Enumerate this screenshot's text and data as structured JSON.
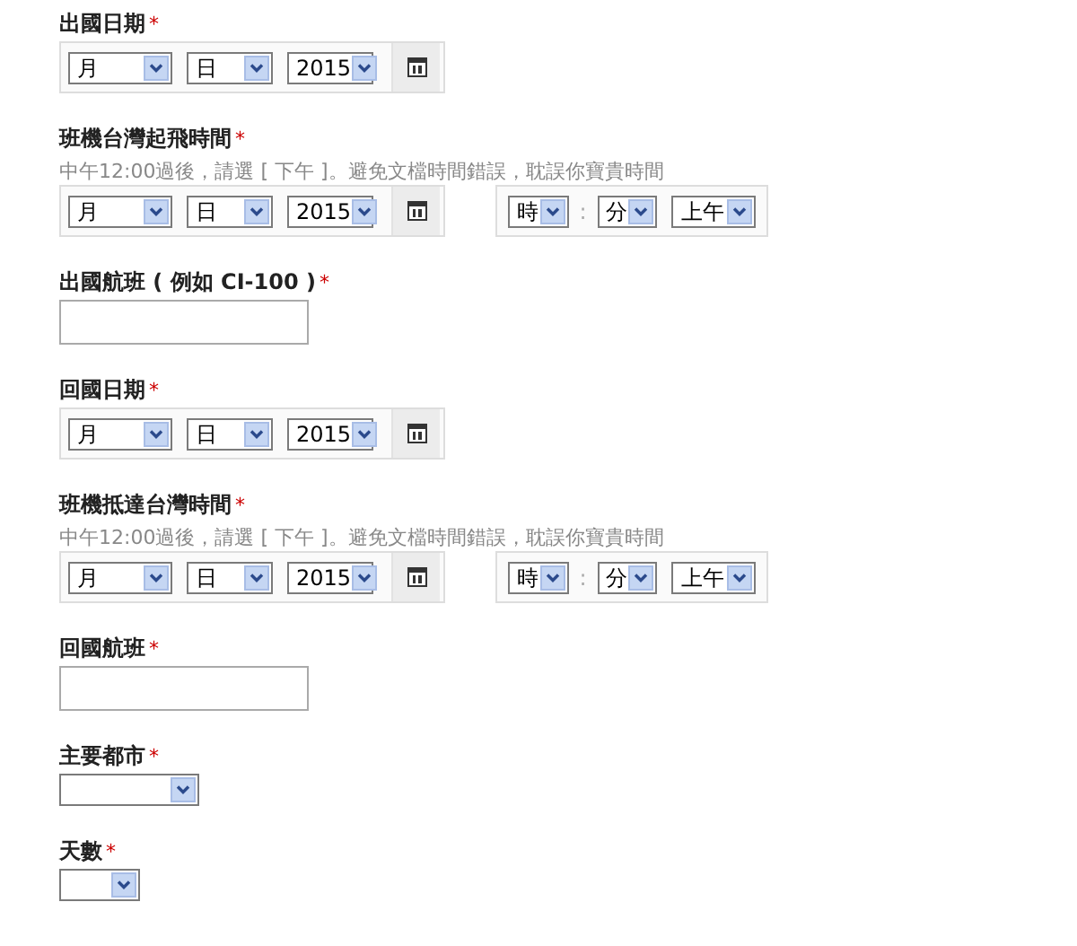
{
  "fields": [
    {
      "kind": "date",
      "label": "出國日期",
      "mark": "*",
      "date": [
        "月",
        "日",
        "2015"
      ]
    },
    {
      "kind": "datetime",
      "label": "班機台灣起飛時間",
      "mark": "*",
      "hint": "中午12:00過後，請選 [ 下午 ]。避免文檔時間錯誤，耽誤你寶貴時間",
      "date": [
        "月",
        "日",
        "2015"
      ],
      "time": [
        "時",
        "分",
        "上午"
      ],
      "separator": ":"
    },
    {
      "kind": "text",
      "label": "出國航班 ( 例如 CI-100 )",
      "mark": "*"
    },
    {
      "kind": "date",
      "label": "回國日期",
      "mark": "*",
      "date": [
        "月",
        "日",
        "2015"
      ]
    },
    {
      "kind": "datetime",
      "label": "班機抵達台灣時間",
      "mark": "*",
      "hint": "中午12:00過後，請選 [ 下午 ]。避免文檔時間錯誤，耽誤你寶貴時間",
      "date": [
        "月",
        "日",
        "2015"
      ],
      "time": [
        "時",
        "分",
        "上午"
      ],
      "separator": ":"
    },
    {
      "kind": "text",
      "label": "回國航班",
      "mark": "*"
    },
    {
      "kind": "select",
      "label": "主要都市",
      "mark": "*"
    },
    {
      "kind": "short_select",
      "label": "天數",
      "mark": "*"
    }
  ]
}
